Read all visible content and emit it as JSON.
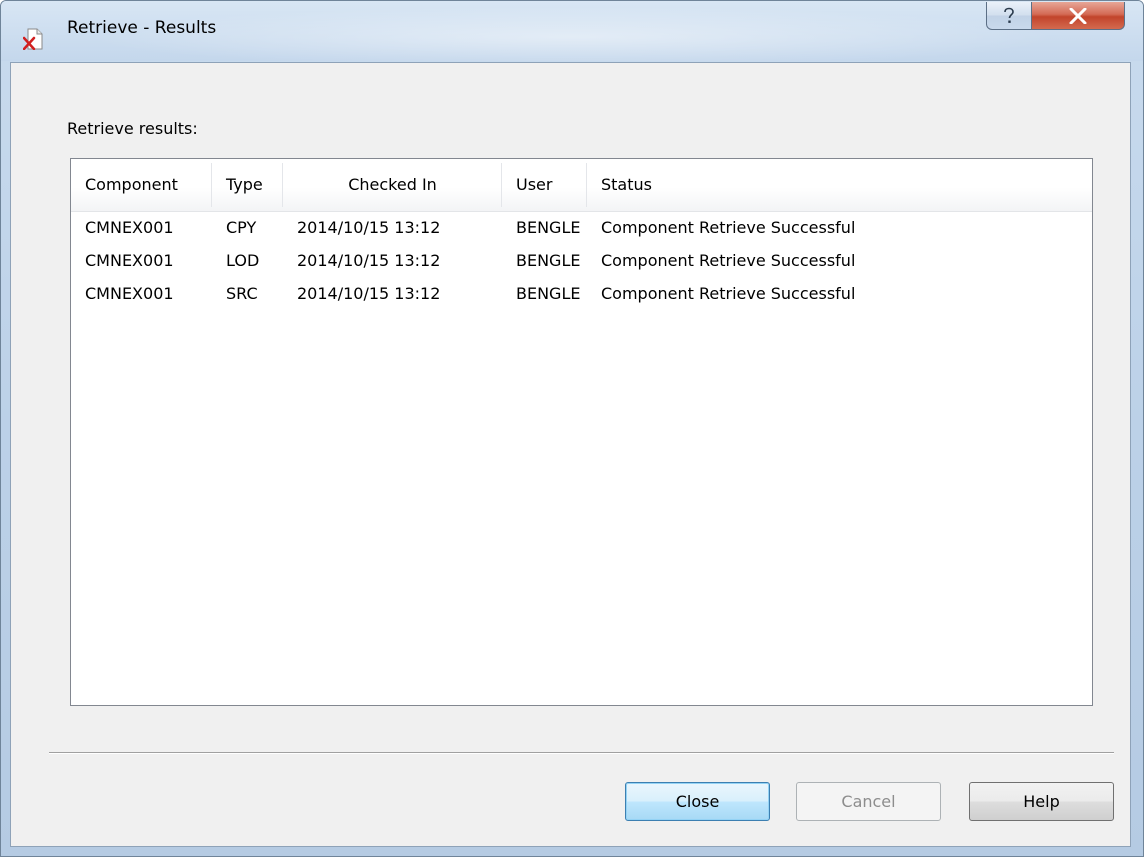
{
  "window": {
    "title": "Retrieve - Results"
  },
  "section_label": "Retrieve results:",
  "table": {
    "columns": [
      "Component",
      "Type",
      "Checked In",
      "User",
      "Status"
    ],
    "rows": [
      [
        "CMNEX001",
        "CPY",
        "2014/10/15  13:12",
        "BENGLE",
        "Component Retrieve Successful"
      ],
      [
        "CMNEX001",
        "LOD",
        "2014/10/15  13:12",
        "BENGLE",
        "Component Retrieve Successful"
      ],
      [
        "CMNEX001",
        "SRC",
        "2014/10/15  13:12",
        "BENGLE",
        "Component Retrieve Successful"
      ]
    ]
  },
  "buttons": {
    "close": "Close",
    "cancel": "Cancel",
    "help": "Help"
  },
  "icons": {
    "app": "retrieve-document-icon",
    "help": "question-mark-icon",
    "close_window": "close-x-icon"
  },
  "colors": {
    "close_window_button": "#c2442b",
    "default_button_border": "#3c7fb1"
  }
}
